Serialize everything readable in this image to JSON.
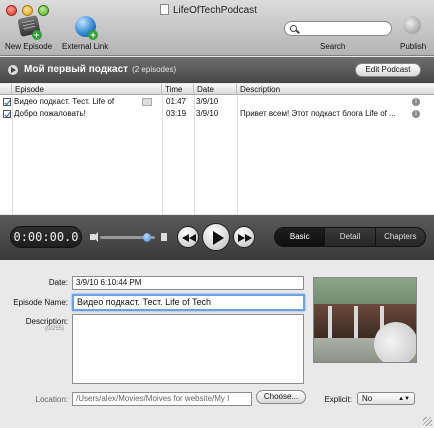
{
  "window": {
    "title": "LifeOfTechPodcast"
  },
  "toolbar": {
    "new_episode": "New Episode",
    "external_link": "External Link",
    "search_label": "Search",
    "search_placeholder": "",
    "publish": "Publish"
  },
  "podcast": {
    "title": "Мой первый подкаст",
    "count": "(2 episodes)",
    "edit_button": "Edit Podcast"
  },
  "table": {
    "columns": [
      "Episode",
      "Time",
      "Date",
      "Description"
    ],
    "rows": [
      {
        "episode": "Видео подкаст. Тест. Life of",
        "time": "01:47",
        "date": "3/9/10",
        "description": ""
      },
      {
        "episode": "Добро пожаловать!",
        "time": "03:19",
        "date": "3/9/10",
        "description": "Привет всем! Этот подкаст блога Life of ..."
      }
    ]
  },
  "player": {
    "time": "0:00:00.0",
    "tabs": [
      "Basic",
      "Detail",
      "Chapters"
    ],
    "active_tab": "Basic",
    "volume_level": 0.85
  },
  "form": {
    "date_label": "Date:",
    "date_value": "3/9/10 6:10:44 PM",
    "episode_name_label": "Episode Name:",
    "episode_name_value": "Видео подкаст. Тест. Life of Tech",
    "description_label": "Description:",
    "description_counter": "(0/255)",
    "description_value": "",
    "location_label": "Location:",
    "location_value": "/Users/alex/Movies/Moives for website/My I",
    "choose_button": "Choose...",
    "explicit_label": "Explicit:",
    "explicit_value": "No"
  }
}
